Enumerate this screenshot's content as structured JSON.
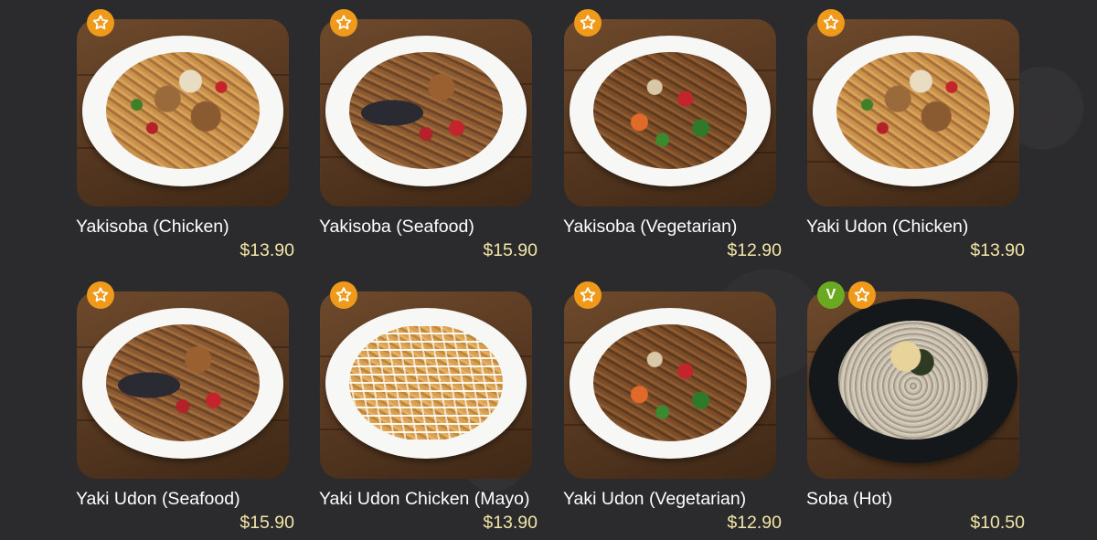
{
  "menu": {
    "items": [
      {
        "name": "Yakisoba (Chicken)",
        "price": "$13.90",
        "style": "chicken",
        "badges": [
          "star"
        ]
      },
      {
        "name": "Yakisoba (Seafood)",
        "price": "$15.90",
        "style": "seafood",
        "badges": [
          "star"
        ]
      },
      {
        "name": "Yakisoba (Vegetarian)",
        "price": "$12.90",
        "style": "veg",
        "badges": [
          "star"
        ]
      },
      {
        "name": "Yaki Udon (Chicken)",
        "price": "$13.90",
        "style": "chicken",
        "badges": [
          "star"
        ]
      },
      {
        "name": "Yaki Udon (Seafood)",
        "price": "$15.90",
        "style": "seafood",
        "badges": [
          "star"
        ]
      },
      {
        "name": "Yaki Udon Chicken (Mayo)",
        "price": "$13.90",
        "style": "mayo",
        "badges": [
          "star"
        ]
      },
      {
        "name": "Yaki Udon (Vegetarian)",
        "price": "$12.90",
        "style": "veg",
        "badges": [
          "star"
        ]
      },
      {
        "name": "Soba (Hot)",
        "price": "$10.50",
        "style": "soba",
        "badges": [
          "vegetarian",
          "star"
        ]
      }
    ],
    "vegetarian_badge_label": "V"
  },
  "colors": {
    "background": "#2b2a2d",
    "star_badge": "#ef9a1a",
    "vegetarian_badge": "#6aa920",
    "item_name": "#ffffff",
    "item_price": "#f3e6a6"
  },
  "icons": {
    "star_badge": "star-icon",
    "vegetarian_badge": "vegetarian-icon"
  }
}
